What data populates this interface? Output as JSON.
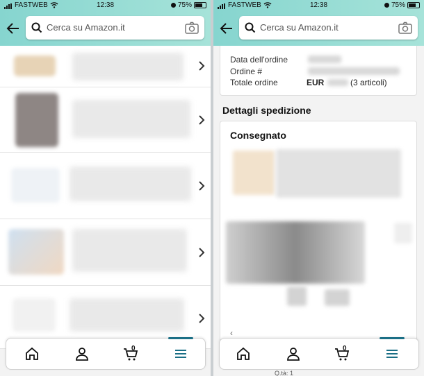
{
  "status": {
    "carrier": "FASTWEB",
    "time": "12:38",
    "battery": "75%"
  },
  "search": {
    "placeholder": "Cerca su Amazon.it"
  },
  "order": {
    "date_label": "Data dell'ordine",
    "number_label": "Ordine #",
    "total_label": "Totale ordine",
    "currency": "EUR",
    "items_note": "(3 articoli)"
  },
  "shipment": {
    "title": "Dettagli spedizione",
    "status": "Consegnato"
  },
  "tabbar": {
    "cart_count": "0"
  },
  "right_bottom": {
    "partial_text": "Q.tà: 1"
  },
  "icons": [
    "back-arrow-icon",
    "search-icon",
    "camera-icon",
    "chevron-right-icon",
    "home-icon",
    "user-icon",
    "cart-icon",
    "menu-icon"
  ],
  "colors": {
    "header": "#92dbd3",
    "active_tab": "#1b6f86"
  }
}
